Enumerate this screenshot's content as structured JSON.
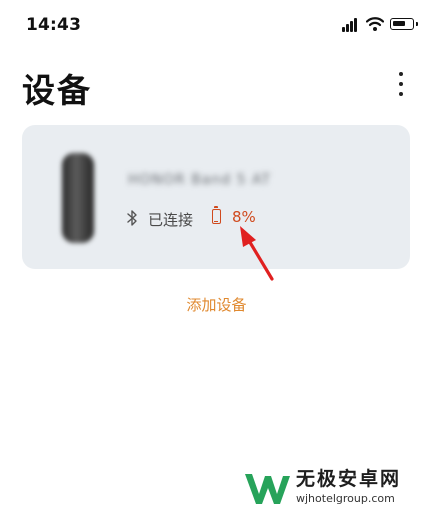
{
  "status_bar": {
    "time": "14:43"
  },
  "header": {
    "title": "设备"
  },
  "device": {
    "name": "HONOR Band 5 AT",
    "connection_status": "已连接",
    "battery_percent": "8%"
  },
  "actions": {
    "add_device": "添加设备"
  },
  "watermark": {
    "title": "无极安卓网",
    "url": "wjhotelgroup.com"
  },
  "colors": {
    "accent_orange": "#e0892f",
    "battery_low_red": "#d04a1e",
    "card_background": "#e9edf1",
    "annotation_arrow": "#e02020"
  },
  "icons": [
    "signal-icon",
    "wifi-icon",
    "battery-icon",
    "more-vertical-icon",
    "bluetooth-icon",
    "battery-low-icon"
  ]
}
